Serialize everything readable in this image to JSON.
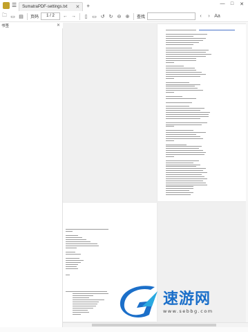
{
  "window": {
    "tab_title": "SumatraPDF-settings.txt",
    "controls": [
      "—",
      "□",
      "✕"
    ]
  },
  "toolbar": {
    "page_label": "页码",
    "page_value": "1 / 2",
    "find_label": "查找",
    "icons": [
      "open-icon",
      "save-icon",
      "print-icon",
      "prev-page-icon",
      "next-page-icon",
      "fit-page-icon",
      "fit-width-icon",
      "rotate-left-icon",
      "rotate-right-icon",
      "zoom-out-icon",
      "zoom-in-icon",
      "find-prev-icon",
      "find-next-icon",
      "match-case-icon"
    ]
  },
  "sidebar": {
    "title": "书签"
  },
  "watermark": {
    "brand_text": "速游网",
    "url_text": "www.sebbg.com",
    "brand_color": "#1b6fc9"
  },
  "colors": {
    "canvas_bg": "#f0f0f0",
    "page_bg": "#ffffff",
    "link": "#4a73c7"
  }
}
